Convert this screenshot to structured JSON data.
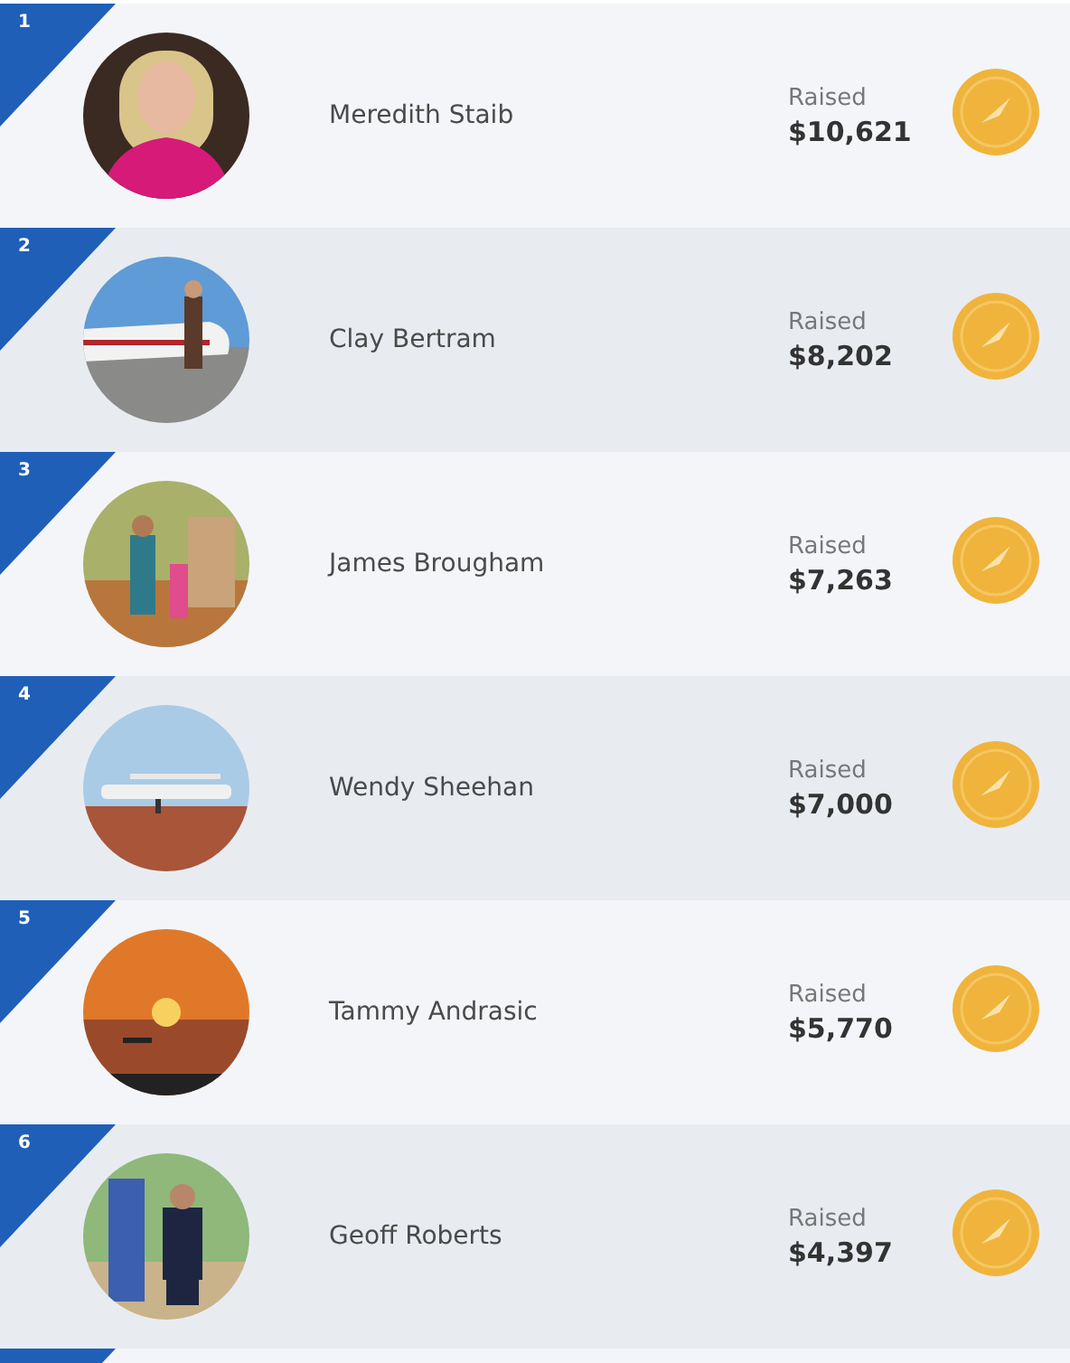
{
  "leaderboard": [
    {
      "rank": "1",
      "name": "Meredith Staib",
      "label": "Raised",
      "amount": "$10,621"
    },
    {
      "rank": "2",
      "name": "Clay Bertram",
      "label": "Raised",
      "amount": "$8,202"
    },
    {
      "rank": "3",
      "name": "James Brougham",
      "label": "Raised",
      "amount": "$7,263"
    },
    {
      "rank": "4",
      "name": "Wendy Sheehan",
      "label": "Raised",
      "amount": "$7,000"
    },
    {
      "rank": "5",
      "name": "Tammy Andrasic",
      "label": "Raised",
      "amount": "$5,770"
    },
    {
      "rank": "6",
      "name": "Geoff Roberts",
      "label": "Raised",
      "amount": "$4,397"
    }
  ]
}
